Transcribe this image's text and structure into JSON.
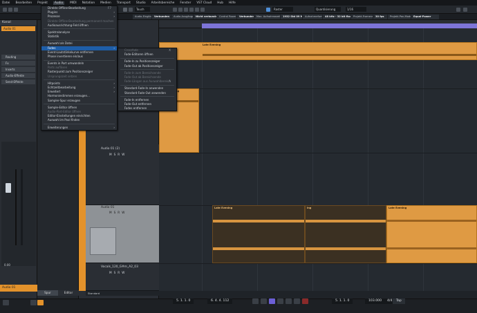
{
  "menubar": [
    "Datei",
    "Bearbeiten",
    "Projekt",
    "Audio",
    "MIDI",
    "Notation",
    "Medien",
    "Transport",
    "Studio",
    "Arbeitsbereiche",
    "Fenster",
    "VST Cloud",
    "Hub",
    "Hilfe"
  ],
  "menubar_active_index": 3,
  "toolbar": {
    "mode_select": "Touch",
    "snap": "Raster",
    "quantize": "Quantisierung",
    "quant_value": "1/16"
  },
  "infobar": [
    "Audio-Eingänge",
    "Verbunden",
    "Audio-Ausgänge",
    "Nicht verbunden",
    "Control Room",
    "Verbunden",
    "Max. Aufnahmezeit",
    "1932 Std 09 Min",
    "Aufnahmeformat",
    "48 kHz - 32 bit float",
    "Projekt-Framerate",
    "30 fps",
    "Projekt-Pan-Modus",
    "Equal-Power"
  ],
  "inspector": {
    "header": "Kanal",
    "track": "Audio 01",
    "sections": [
      "Routing",
      "Fx",
      "Inserts",
      "Audio-Effekte",
      "Send-Effekte"
    ],
    "fader_value": "0.00",
    "bottom_label": "Audio 01"
  },
  "bottom_tabs": [
    "Spur",
    "Editor"
  ],
  "tracklist": {
    "tracks": [
      {
        "name": "Audio 01 (2)"
      },
      {
        "name": "Audio 01"
      },
      {
        "name": "Vocals_120_G#m_A2_03"
      }
    ],
    "btn_labels": [
      "M",
      "S",
      "R",
      "W"
    ],
    "footer": "Standard"
  },
  "clips": [
    {
      "name": "Late Evening"
    },
    {
      "name": "Late Evening"
    },
    {
      "name": "ing"
    },
    {
      "name": "Late Evening"
    }
  ],
  "audio_menu": {
    "items": [
      {
        "label": "Direkte Offline-Bearbeitung",
        "shortcut": "F7",
        "type": "item"
      },
      {
        "label": "Plugins",
        "type": "sub"
      },
      {
        "label": "Prozesse",
        "type": "sub"
      },
      {
        "label": "Direkte Offline-Bearbeitung permanent machen",
        "type": "dis"
      },
      {
        "label": "Audioausrichtung-Feld öffnen",
        "type": "item"
      },
      {
        "type": "sep"
      },
      {
        "label": "Spektralanalyse",
        "type": "item"
      },
      {
        "label": "Statistik",
        "type": "item"
      },
      {
        "type": "sep"
      },
      {
        "label": "Auswahl als Datei",
        "type": "item"
      },
      {
        "label": "Fades",
        "type": "hl"
      },
      {
        "label": "Event-Lautstärkekurve entfernen",
        "type": "item"
      },
      {
        "label": "Phase invertieren ein/aus",
        "type": "item"
      },
      {
        "type": "sep"
      },
      {
        "label": "Events in Part umwandeln",
        "type": "item"
      },
      {
        "label": "Parts auflösen",
        "type": "dis"
      },
      {
        "label": "Rasterpunkt zum Positionszeiger",
        "type": "item"
      },
      {
        "label": "Ursprungszeit setzen",
        "type": "dis"
      },
      {
        "type": "sep"
      },
      {
        "label": "Hitpoints",
        "type": "sub"
      },
      {
        "label": "Echtzeitbearbeitung",
        "type": "sub"
      },
      {
        "label": "Erweitert",
        "type": "sub"
      },
      {
        "label": "Harmoniestimmen erzeugen...",
        "type": "item"
      },
      {
        "label": "Sampler-Spur erzeugen",
        "type": "item"
      },
      {
        "type": "sep"
      },
      {
        "label": "Sample-Editor öffnen",
        "type": "item"
      },
      {
        "label": "Audio-Part-Editor öffnen",
        "type": "dis"
      },
      {
        "label": "Editor-Einstellungen einrichten",
        "type": "item"
      },
      {
        "label": "Auswahl im Pool finden",
        "type": "item"
      },
      {
        "type": "sep"
      },
      {
        "label": "Erweiterungen",
        "type": "sub"
      }
    ]
  },
  "fades_menu": {
    "items": [
      {
        "label": "Crossfade",
        "shortcut": "X",
        "type": "dis"
      },
      {
        "label": "Fade-Editoren öffnen",
        "type": "item"
      },
      {
        "type": "sep"
      },
      {
        "label": "Fade-In zu Positionszeiger",
        "type": "item"
      },
      {
        "label": "Fade-Out ab Positionszeiger",
        "type": "item"
      },
      {
        "type": "sep"
      },
      {
        "label": "Fade-In zum Bereichsende",
        "type": "dis"
      },
      {
        "label": "Fade-Out ab Bereichsende",
        "type": "dis"
      },
      {
        "label": "Fade-Längen aus Auswahlbereich",
        "shortcut": "A",
        "type": "dis"
      },
      {
        "type": "sep"
      },
      {
        "label": "Standard-Fade-In anwenden",
        "type": "item"
      },
      {
        "label": "Standard-Fade-Out anwenden",
        "type": "item"
      },
      {
        "type": "sep"
      },
      {
        "label": "Fade-In entfernen",
        "type": "item"
      },
      {
        "label": "Fade-Out entfernen",
        "type": "item"
      },
      {
        "label": "Fades entfernen",
        "type": "item"
      }
    ]
  },
  "transport": {
    "left_locator": "5. 1. 1. 0",
    "right_locator": "6. 4. 4. 112",
    "position": "5. 1. 1. 0",
    "tempo": "103.000",
    "signature": "4/4",
    "tap_label": "Tap"
  },
  "colors": {
    "accent": "#e3922b",
    "clip": "#df9a43",
    "loop": "#7d74d8",
    "highlight": "#1e5ea8"
  }
}
